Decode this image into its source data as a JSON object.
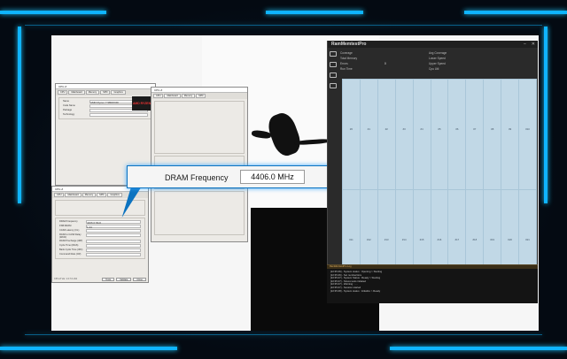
{
  "callout": {
    "label": "DRAM Frequency",
    "value": "4406.0 MHz"
  },
  "cpuz_front": {
    "title": "CPU-Z",
    "tabs": [
      "CPU",
      "Mainboard",
      "Memory",
      "SPD",
      "Graphics",
      "Bench",
      "About"
    ],
    "footer_version": "CPU-Z  Ver. 2.17.0.x64",
    "tools_label": "Tools",
    "validate_label": "Validate",
    "close_label": "Close",
    "memory_rows": [
      "DRAM Frequency",
      "FSB:DRAM",
      "CAS# Latency (CL)",
      "RAS# to CAS# Delay (tRCD)",
      "RAS# Precharge (tRP)",
      "Cycle Time (tRAS)",
      "Bank Cycle Time (tRC)",
      "Command Rate (CR)"
    ],
    "memory_values": [
      "4406.0 MHz",
      "1:44",
      "",
      "",
      "",
      "",
      "",
      ""
    ]
  },
  "cpuz_back": {
    "title": "CPU-Z",
    "tabs": [
      "CPU",
      "Mainboard",
      "Memory",
      "SPD",
      "Graphics",
      "Bench",
      "About"
    ],
    "name_value": "AMD Ryzen 7 9800X3D",
    "brand": "AMD RYZEN"
  },
  "cpuz_mainboard": {
    "title": "CPU-Z",
    "tabs": [
      "CPU",
      "Mainboard",
      "Memory",
      "SPD",
      "Graphics",
      "Bench",
      "About"
    ]
  },
  "ramwin": {
    "title": "RamMemtestPro",
    "stats": [
      {
        "k": "Coverage",
        "v": ""
      },
      {
        "k": "Total Memory",
        "v": ""
      },
      {
        "k": "Errors",
        "v": "0"
      },
      {
        "k": "Run Time",
        "v": ""
      }
    ],
    "stats2": [
      {
        "k": "Avg Coverage",
        "v": ""
      },
      {
        "k": "Lower Speed",
        "v": ""
      },
      {
        "k": "Upper Speed",
        "v": ""
      },
      {
        "k": "Cpu Util",
        "v": ""
      }
    ],
    "cells": [
      "#0",
      "#1",
      "#2",
      "#3",
      "#4",
      "#5",
      "#6",
      "#7",
      "#8",
      "#9",
      "#10",
      "#11",
      "#12",
      "#13",
      "#14",
      "#15",
      "#16",
      "#17",
      "#18",
      "#19",
      "#20",
      "#21"
    ]
  },
  "log": {
    "header": "RamMemtestPro Log",
    "lines": [
      "[22:35:46] - System status : Opening > Starting",
      "[22:35:46] - Set number/size",
      "[22:35:47] - System Status : Ready > Starting",
      "[22:35:47] - Stress tests initiated",
      "[22:35:47] - Warning : ....",
      "[22:35:47] - Session started",
      "[22:35:48] - System status : Initialize > Ready"
    ]
  }
}
